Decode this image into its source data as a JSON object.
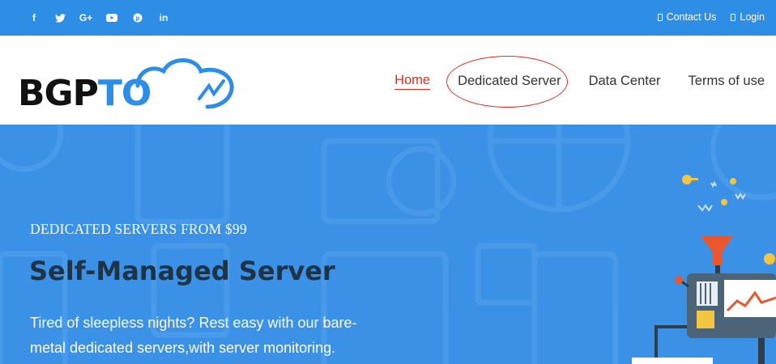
{
  "topbar": {
    "social": [
      {
        "icon": "facebook-icon",
        "glyph": "f"
      },
      {
        "icon": "twitter-icon",
        "glyph": "🐦"
      },
      {
        "icon": "google-plus-icon",
        "glyph": "G+"
      },
      {
        "icon": "youtube-icon",
        "glyph": "▶"
      },
      {
        "icon": "pinterest-icon",
        "glyph": "℗"
      },
      {
        "icon": "linkedin-icon",
        "glyph": "in"
      }
    ],
    "contact_label": "Contact Us",
    "login_label": "Login"
  },
  "header": {
    "logo_text_a": "BGP",
    "logo_text_b": "TO",
    "nav": {
      "home": "Home",
      "dedicated": "Dedicated Server",
      "datacenter": "Data Center",
      "terms": "Terms of use"
    }
  },
  "hero": {
    "kicker": "DEDICATED SERVERS FROM $99",
    "title": "Self-Managed Server",
    "description": "Tired of sleepless nights? Rest easy with our bare-metal dedicated servers,with server monitoring."
  },
  "colors": {
    "brand_blue": "#2e8ee6",
    "hero_blue": "#3a91e6",
    "active_red": "#d93025",
    "title_dark": "#1f3347"
  }
}
